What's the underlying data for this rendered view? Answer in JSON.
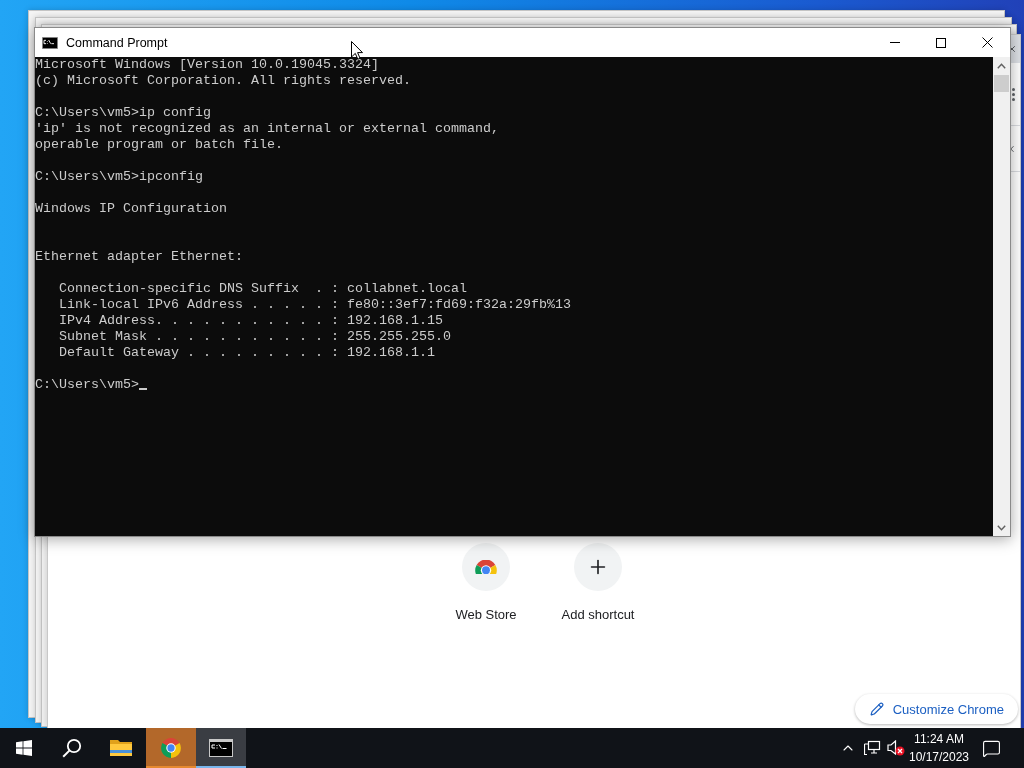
{
  "command_prompt": {
    "title": "Command Prompt",
    "lines": [
      {
        "kind": "text",
        "text": "Microsoft Windows [Version 10.0.19045.3324]"
      },
      {
        "kind": "text",
        "text": "(c) Microsoft Corporation. All rights reserved."
      },
      {
        "kind": "blank"
      },
      {
        "kind": "text",
        "text": "C:\\Users\\vm5>ip config"
      },
      {
        "kind": "text",
        "text": "'ip' is not recognized as an internal or external command,"
      },
      {
        "kind": "text",
        "text": "operable program or batch file."
      },
      {
        "kind": "blank"
      },
      {
        "kind": "text",
        "text": "C:\\Users\\vm5>ipconfig"
      },
      {
        "kind": "blank"
      },
      {
        "kind": "text",
        "text": "Windows IP Configuration"
      },
      {
        "kind": "blank"
      },
      {
        "kind": "blank"
      },
      {
        "kind": "text",
        "text": "Ethernet adapter Ethernet:"
      },
      {
        "kind": "blank"
      },
      {
        "kind": "detail",
        "text": "Connection-specific DNS Suffix  . : collabnet.local"
      },
      {
        "kind": "detail",
        "text": "Link-local IPv6 Address . . . . . : fe80::3ef7:fd69:f32a:29fb%13"
      },
      {
        "kind": "detail",
        "text": "IPv4 Address. . . . . . . . . . . : 192.168.1.15"
      },
      {
        "kind": "detail",
        "text": "Subnet Mask . . . . . . . . . . . : 255.255.255.0"
      },
      {
        "kind": "detail",
        "text": "Default Gateway . . . . . . . . . : 192.168.1.1"
      },
      {
        "kind": "blank"
      }
    ],
    "prompt": {
      "text": "C:\\Users\\vm5>",
      "cursor": true
    }
  },
  "browser": {
    "shortcuts": [
      {
        "kind": "store",
        "label": "Web Store"
      },
      {
        "kind": "add",
        "label": "Add shortcut"
      }
    ],
    "customize_button": "Customize Chrome"
  },
  "taskbar": {
    "apps": [
      {
        "kind": "folder",
        "active": false,
        "attention": false
      },
      {
        "kind": "browser",
        "active": false,
        "attention": true
      },
      {
        "kind": "terminal",
        "active": true,
        "attention": false
      }
    ],
    "tray": {
      "volume_muted": true
    },
    "clock": {
      "time": "11:24 AM",
      "date": "10/17/2023"
    }
  }
}
